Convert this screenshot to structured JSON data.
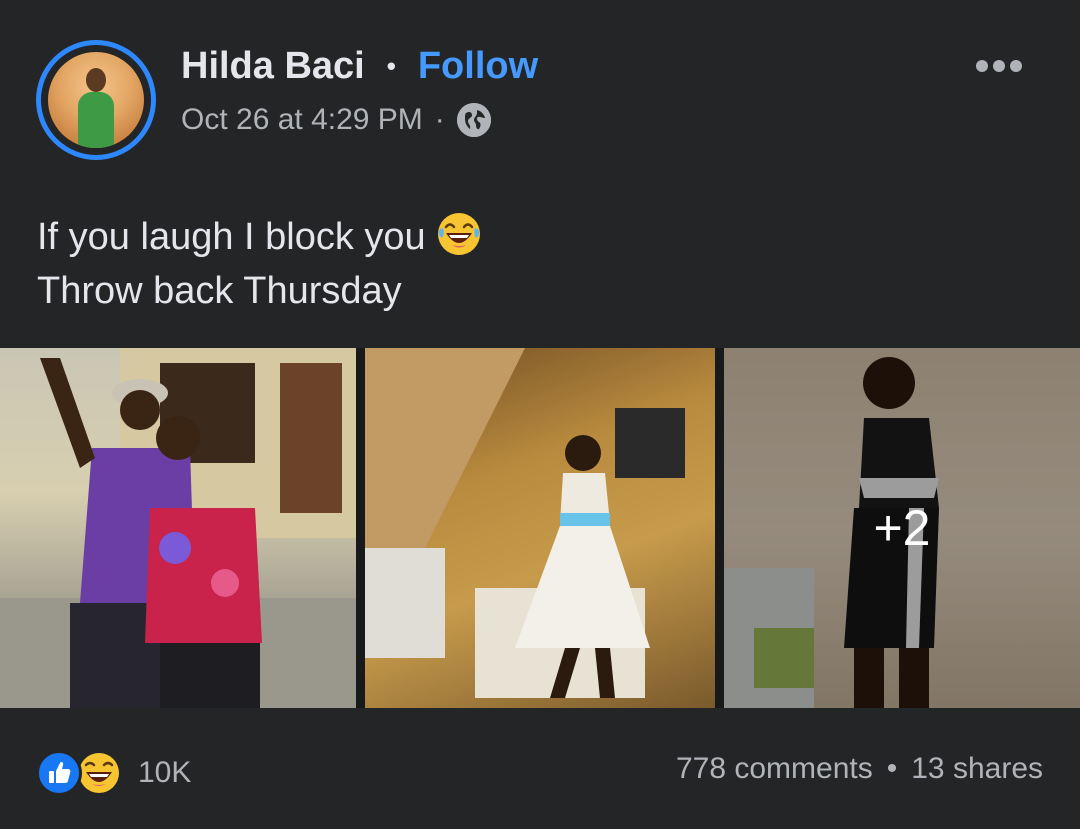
{
  "post": {
    "author_name": "Hilda Baci",
    "follow_label": "Follow",
    "separator": "•",
    "timestamp": "Oct 26 at 4:29 PM",
    "meta_separator": "·",
    "privacy_icon": "globe-icon",
    "more_icon": "more-options-icon",
    "text_line_1": "If you laugh I block you",
    "text_line_2": "Throw back Thursday",
    "text_emoji_icon": "laughing-tears-emoji",
    "photos": [
      {
        "name": "photo-1"
      },
      {
        "name": "photo-2"
      },
      {
        "name": "photo-3",
        "more_count": "+2"
      }
    ],
    "reactions": {
      "icons": [
        "like-icon",
        "haha-icon"
      ],
      "count": "10K"
    },
    "comments": "778 comments",
    "engagement_separator": "•",
    "shares": "13 shares"
  },
  "colors": {
    "background": "#242526",
    "accent_blue": "#4599ff",
    "avatar_ring": "#2d88ff",
    "secondary_text": "#b0b3b8",
    "primary_text": "#e4e6eb"
  }
}
